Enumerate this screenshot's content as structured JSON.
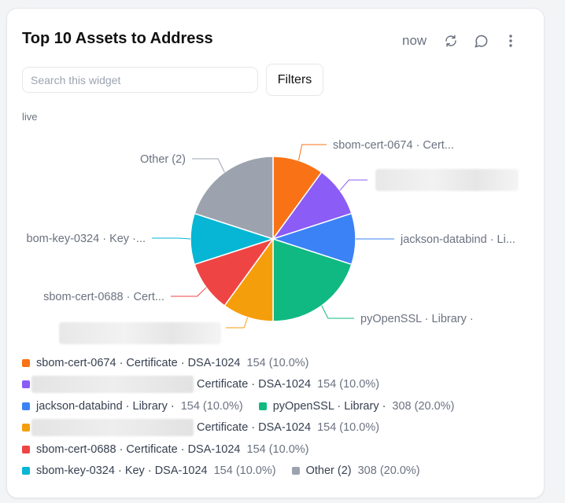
{
  "widget": {
    "title": "Top 10 Assets to Address",
    "refresh_status": "now",
    "search_placeholder": "Search this widget",
    "filters_label": "Filters",
    "mode_label": "live",
    "icons": [
      "refresh-icon",
      "comment-icon",
      "more-vertical-icon"
    ]
  },
  "chart_data": {
    "type": "pie",
    "slices": [
      {
        "label": "sbom-cert-0674 · Cert...",
        "legend": "sbom-cert-0674 · Certificate · DSA-1024",
        "value": 154,
        "percent": "154 (10.0%)",
        "color": "#f97316",
        "blurred": false
      },
      {
        "label": "",
        "legend": "Certificate · DSA-1024",
        "value": 154,
        "percent": "154 (10.0%)",
        "color": "#8b5cf6",
        "blurred": true
      },
      {
        "label": "jackson-databind · Li...",
        "legend": "jackson-databind · Library ·",
        "value": 154,
        "percent": "154 (10.0%)",
        "color": "#3b82f6",
        "blurred": false
      },
      {
        "label": "pyOpenSSL · Library ·",
        "legend": "pyOpenSSL · Library ·",
        "value": 308,
        "percent": "308 (20.0%)",
        "color": "#10b981",
        "blurred": false
      },
      {
        "label": "",
        "legend": "Certificate · DSA-1024",
        "value": 154,
        "percent": "154 (10.0%)",
        "color": "#f59e0b",
        "blurred": true
      },
      {
        "label": "sbom-cert-0688 · Cert...",
        "legend": "sbom-cert-0688 · Certificate · DSA-1024",
        "value": 154,
        "percent": "154 (10.0%)",
        "color": "#ef4444",
        "blurred": false
      },
      {
        "label": "bom-key-0324 · Key ·...",
        "legend": "sbom-key-0324 · Key · DSA-1024",
        "value": 154,
        "percent": "154 (10.0%)",
        "color": "#06b6d4",
        "blurred": false
      },
      {
        "label": "Other (2)",
        "legend": "Other (2)",
        "value": 308,
        "percent": "308 (20.0%)",
        "color": "#9ca3af",
        "blurred": false
      }
    ],
    "legend_rows": [
      [
        0
      ],
      [
        1
      ],
      [
        2,
        3
      ],
      [
        4
      ],
      [
        5
      ],
      [
        6,
        7
      ]
    ]
  }
}
